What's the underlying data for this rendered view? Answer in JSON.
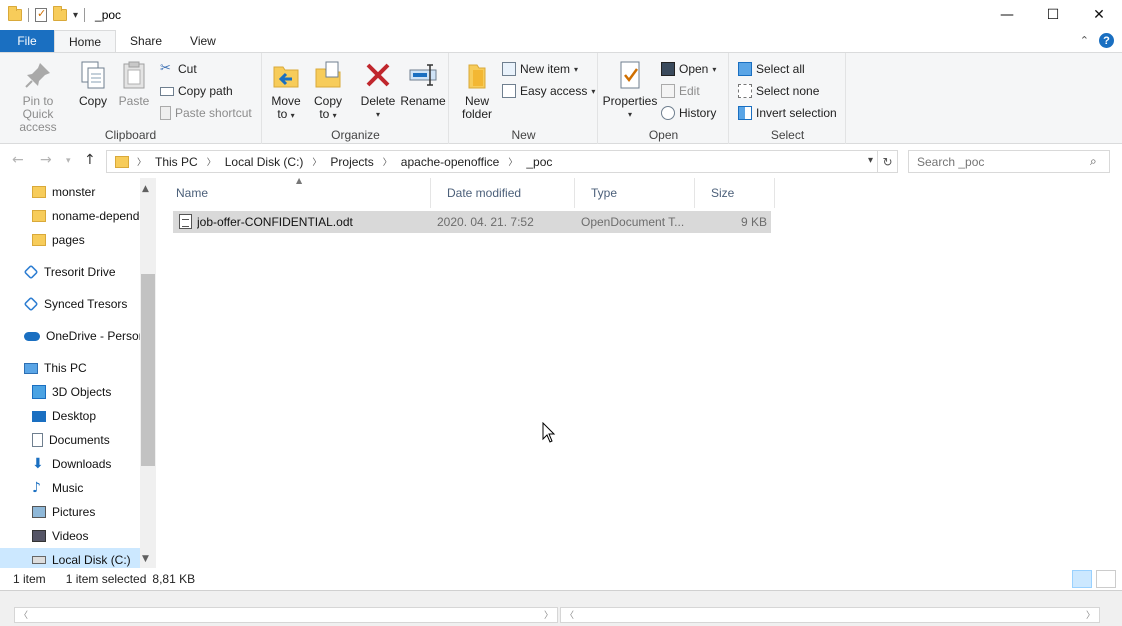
{
  "window": {
    "title": "_poc",
    "controls": [
      "minimize",
      "maximize",
      "close"
    ],
    "qat_customize_icon": "chevron-down-icon"
  },
  "ribbon_tabs": {
    "file": "File",
    "home": "Home",
    "share": "Share",
    "view": "View",
    "active": "Home"
  },
  "ribbon": {
    "clipboard": {
      "label": "Clipboard",
      "pin": "Pin to Quick access",
      "pin_l1": "Pin to Quick",
      "pin_l2": "access",
      "copy": "Copy",
      "paste": "Paste",
      "cut": "Cut",
      "copy_path": "Copy path",
      "paste_shortcut": "Paste shortcut"
    },
    "organize": {
      "label": "Organize",
      "move_l1": "Move",
      "move_l2": "to",
      "copy_l1": "Copy",
      "copy_l2": "to",
      "delete": "Delete",
      "rename": "Rename"
    },
    "new": {
      "label": "New",
      "folder_l1": "New",
      "folder_l2": "folder",
      "new_item": "New item",
      "easy_access": "Easy access"
    },
    "open": {
      "label": "Open",
      "properties": "Properties",
      "open": "Open",
      "edit": "Edit",
      "history": "History"
    },
    "select": {
      "label": "Select",
      "select_all": "Select all",
      "select_none": "Select none",
      "invert": "Invert selection"
    }
  },
  "address": {
    "crumbs": [
      "This PC",
      "Local Disk (C:)",
      "Projects",
      "apache-openoffice",
      "_poc"
    ],
    "search_placeholder": "Search _poc"
  },
  "nav_pane": {
    "items": [
      {
        "label": "monster",
        "icon": "folder-icon"
      },
      {
        "label": "noname-depende",
        "icon": "folder-icon"
      },
      {
        "label": "pages",
        "icon": "folder-icon"
      },
      {
        "label": "Tresorit Drive",
        "icon": "tresorit-icon"
      },
      {
        "label": "Synced Tresors",
        "icon": "tresorit-icon"
      },
      {
        "label": "OneDrive - Persor",
        "icon": "cloud-icon"
      },
      {
        "label": "This PC",
        "icon": "computer-icon"
      },
      {
        "label": "3D Objects",
        "icon": "cube-icon"
      },
      {
        "label": "Desktop",
        "icon": "desktop-icon"
      },
      {
        "label": "Documents",
        "icon": "document-icon"
      },
      {
        "label": "Downloads",
        "icon": "download-icon"
      },
      {
        "label": "Music",
        "icon": "music-icon"
      },
      {
        "label": "Pictures",
        "icon": "picture-icon"
      },
      {
        "label": "Videos",
        "icon": "video-icon"
      },
      {
        "label": "Local Disk (C:)",
        "icon": "drive-icon",
        "selected": true
      }
    ]
  },
  "file_list": {
    "columns": {
      "name": "Name",
      "date": "Date modified",
      "type": "Type",
      "size": "Size"
    },
    "rows": [
      {
        "name": "job-offer-CONFIDENTIAL.odt",
        "date": "2020. 04. 21. 7:52",
        "type": "OpenDocument T...",
        "size": "9 KB",
        "selected": true
      }
    ]
  },
  "status": {
    "count": "1 item",
    "selection": "1 item selected",
    "size": "8,81 KB",
    "view": "details"
  }
}
